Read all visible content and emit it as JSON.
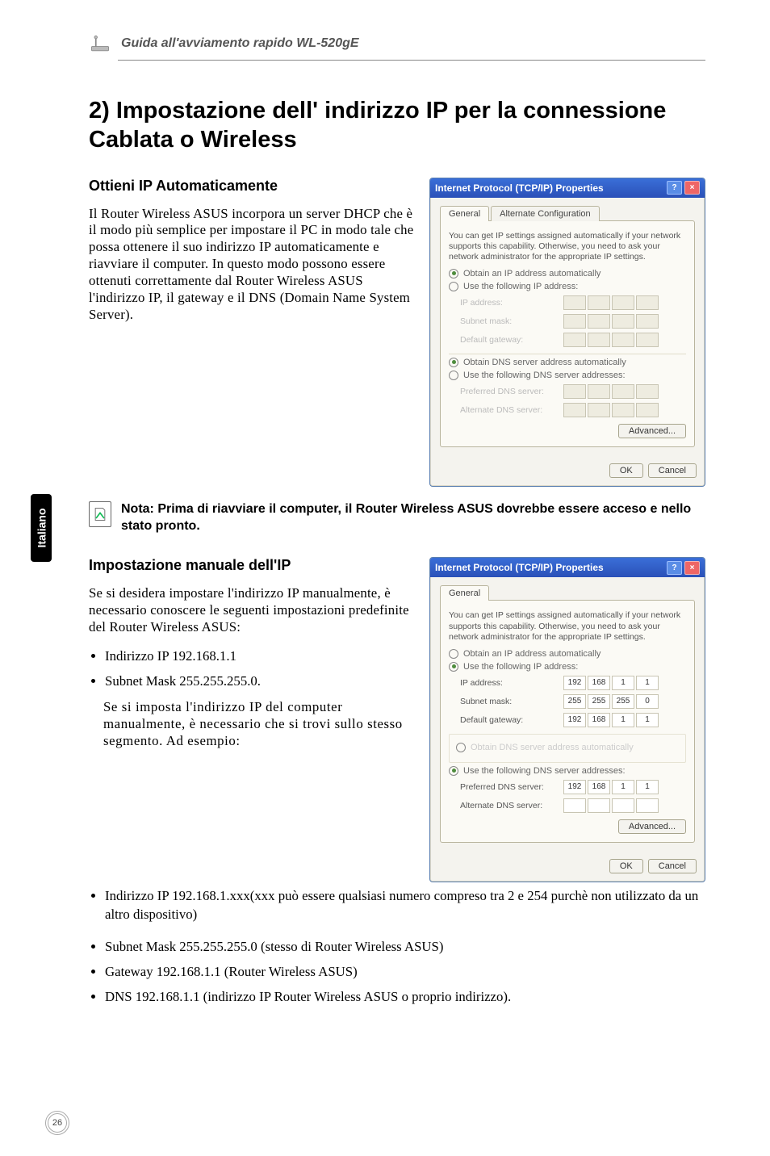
{
  "header": {
    "title": "Guida all'avviamento rapido WL-520gE"
  },
  "side_tab": "Italiano",
  "page_number": "26",
  "main_title": "2) Impostazione dell' indirizzo IP per la connessione Cablata o Wireless",
  "section1": {
    "heading": "Ottieni IP Automaticamente",
    "paragraph": "Il Router Wireless ASUS incorpora un server DHCP che è il modo più semplice per impostare il PC in modo tale che possa ottenere il suo indirizzo IP automaticamente e riavviare il computer. In questo modo possono essere ottenuti correttamente dal Router Wireless ASUS l'indirizzo IP, il gateway e il DNS (Domain Name System Server)."
  },
  "note": "Nota: Prima di riavviare il computer, il Router Wireless ASUS dovrebbe essere acceso e nello stato pronto.",
  "section2": {
    "heading": "Impostazione manuale dell'IP",
    "paragraph": "Se si desidera impostare l'indirizzo IP manualmente, è necessario conoscere le seguenti impostazioni predefinite del Router Wireless ASUS:",
    "bullets_a": [
      "Indirizzo IP 192.168.1.1",
      "Subnet Mask 255.255.255.0."
    ],
    "indent_para": "Se si imposta l'indirizzo IP del computer manualmente, è necessario che si trovi sullo stesso segmento. Ad esempio:",
    "bullets_b": [
      "Indirizzo IP 192.168.1.xxx(xxx può essere qualsiasi numero compreso tra 2 e 254 purchè non utilizzato da un altro dispositivo)",
      "Subnet Mask 255.255.255.0 (stesso di Router Wireless ASUS)",
      "Gateway 192.168.1.1 (Router Wireless ASUS)",
      "DNS 192.168.1.1 (indirizzo IP Router Wireless ASUS o proprio indirizzo)."
    ]
  },
  "dialog1": {
    "title": "Internet Protocol (TCP/IP) Properties",
    "tabs": [
      "General",
      "Alternate Configuration"
    ],
    "blurb": "You can get IP settings assigned automatically if your network supports this capability. Otherwise, you need to ask your network administrator for the appropriate IP settings.",
    "opt_auto_ip": "Obtain an IP address automatically",
    "opt_use_ip": "Use the following IP address:",
    "lbl_ip": "IP address:",
    "lbl_subnet": "Subnet mask:",
    "lbl_gateway": "Default gateway:",
    "opt_auto_dns": "Obtain DNS server address automatically",
    "opt_use_dns": "Use the following DNS server addresses:",
    "lbl_pref_dns": "Preferred DNS server:",
    "lbl_alt_dns": "Alternate DNS server:",
    "btn_adv": "Advanced...",
    "btn_ok": "OK",
    "btn_cancel": "Cancel"
  },
  "dialog2": {
    "title": "Internet Protocol (TCP/IP) Properties",
    "tabs": [
      "General"
    ],
    "blurb": "You can get IP settings assigned automatically if your network supports this capability. Otherwise, you need to ask your network administrator for the appropriate IP settings.",
    "opt_auto_ip": "Obtain an IP address automatically",
    "opt_use_ip": "Use the following IP address:",
    "lbl_ip": "IP address:",
    "lbl_subnet": "Subnet mask:",
    "lbl_gateway": "Default gateway:",
    "ip": [
      "192",
      "168",
      "1",
      "1"
    ],
    "subnet": [
      "255",
      "255",
      "255",
      "0"
    ],
    "gateway": [
      "192",
      "168",
      "1",
      "1"
    ],
    "opt_auto_dns": "Obtain DNS server address automatically",
    "opt_use_dns": "Use the following DNS server addresses:",
    "lbl_pref_dns": "Preferred DNS server:",
    "lbl_alt_dns": "Alternate DNS server:",
    "pref_dns": [
      "192",
      "168",
      "1",
      "1"
    ],
    "btn_adv": "Advanced...",
    "btn_ok": "OK",
    "btn_cancel": "Cancel"
  }
}
